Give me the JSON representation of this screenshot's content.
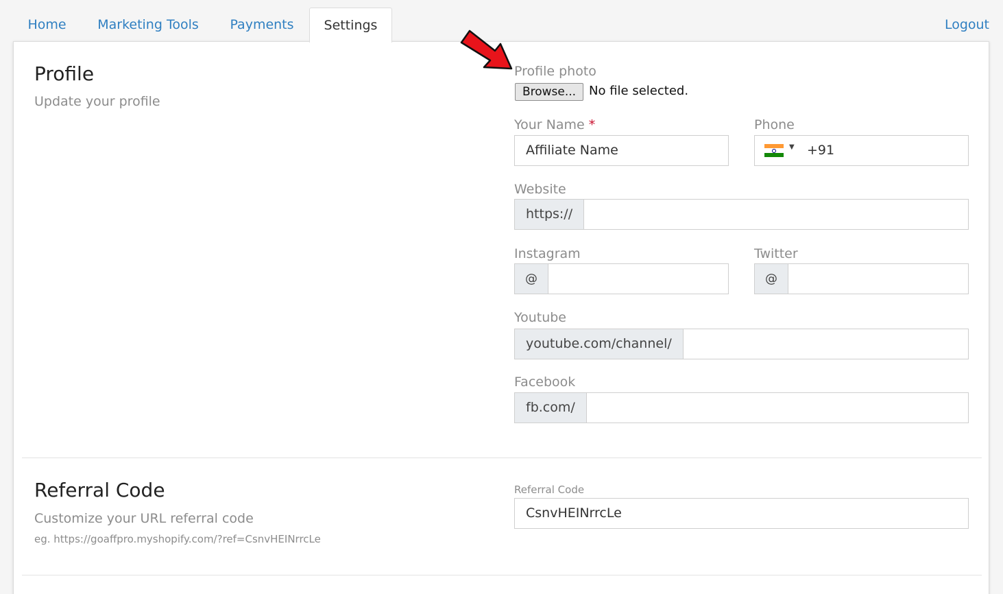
{
  "nav": {
    "tabs": [
      {
        "label": "Home"
      },
      {
        "label": "Marketing Tools"
      },
      {
        "label": "Payments"
      },
      {
        "label": "Settings"
      }
    ],
    "logout_label": "Logout"
  },
  "profile": {
    "title": "Profile",
    "subtitle": "Update your profile",
    "photo_label": "Profile photo",
    "browse_label": "Browse...",
    "no_file_text": "No file selected.",
    "name_label": "Your Name",
    "required_mark": "*",
    "name_value": "Affiliate Name",
    "phone_label": "Phone",
    "phone_value": "+91",
    "website_label": "Website",
    "website_prefix": "https://",
    "instagram_label": "Instagram",
    "instagram_prefix": "@",
    "twitter_label": "Twitter",
    "twitter_prefix": "@",
    "youtube_label": "Youtube",
    "youtube_prefix": "youtube.com/channel/",
    "facebook_label": "Facebook",
    "facebook_prefix": "fb.com/"
  },
  "referral": {
    "title": "Referral Code",
    "subtitle": "Customize your URL referral code",
    "example": "eg. https://goaffpro.myshopify.com/?ref=CsnvHEINrrcLe",
    "field_label": "Referral Code",
    "field_value": "CsnvHEINrrcLe"
  },
  "colors": {
    "link": "#2f7fc1",
    "required": "#c8102e",
    "annotation_arrow": "#e8141b",
    "flag_saffron": "#ff9933",
    "flag_white": "#ffffff",
    "flag_green": "#138808"
  },
  "icons": {
    "country_flag": "india-flag-icon",
    "dropdown": "caret-down-icon",
    "annotation": "red-arrow-icon"
  }
}
